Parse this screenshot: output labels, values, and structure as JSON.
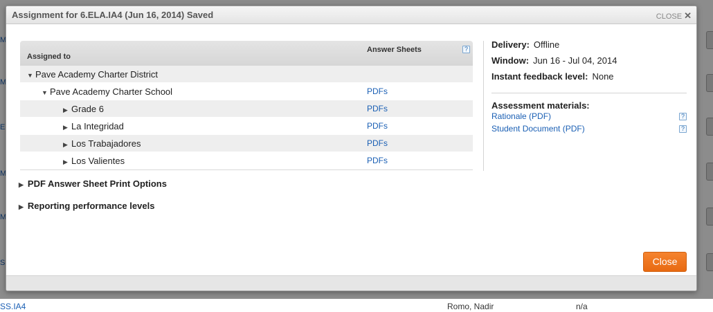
{
  "background": {
    "left_stubs": [
      "M",
      "M",
      "E",
      "M",
      "M",
      "M",
      "SS"
    ],
    "bottom_row": {
      "code": "SS.IA4",
      "name": "Romo, Nadir",
      "status": "n/a"
    }
  },
  "dialog": {
    "title": "Assignment for 6.ELA.IA4 (Jun 16, 2014) Saved",
    "close_link": "CLOSE",
    "close_x": "✕",
    "close_button": "Close"
  },
  "table": {
    "col_assigned": "Assigned to",
    "col_sheets": "Answer Sheets",
    "help": "?",
    "rows": [
      {
        "label": "Pave Academy Charter District",
        "pdf": ""
      },
      {
        "label": "Pave Academy Charter School",
        "pdf": "PDFs"
      },
      {
        "label": "Grade 6",
        "pdf": "PDFs"
      },
      {
        "label": "La Integridad",
        "pdf": "PDFs"
      },
      {
        "label": "Los Trabajadores",
        "pdf": "PDFs"
      },
      {
        "label": "Los Valientes",
        "pdf": "PDFs"
      }
    ]
  },
  "sections": {
    "print_options": "PDF Answer Sheet Print Options",
    "reporting": "Reporting performance levels"
  },
  "info": {
    "delivery_label": "Delivery:",
    "delivery_value": "Offline",
    "window_label": "Window:",
    "window_value": "Jun 16 - Jul 04, 2014",
    "feedback_label": "Instant feedback level:",
    "feedback_value": "None",
    "materials_title": "Assessment materials:",
    "materials": [
      "Rationale (PDF)",
      "Student Document (PDF)"
    ]
  },
  "colors": {
    "link": "#1a5fb4",
    "accent_button": "#ee7420"
  }
}
